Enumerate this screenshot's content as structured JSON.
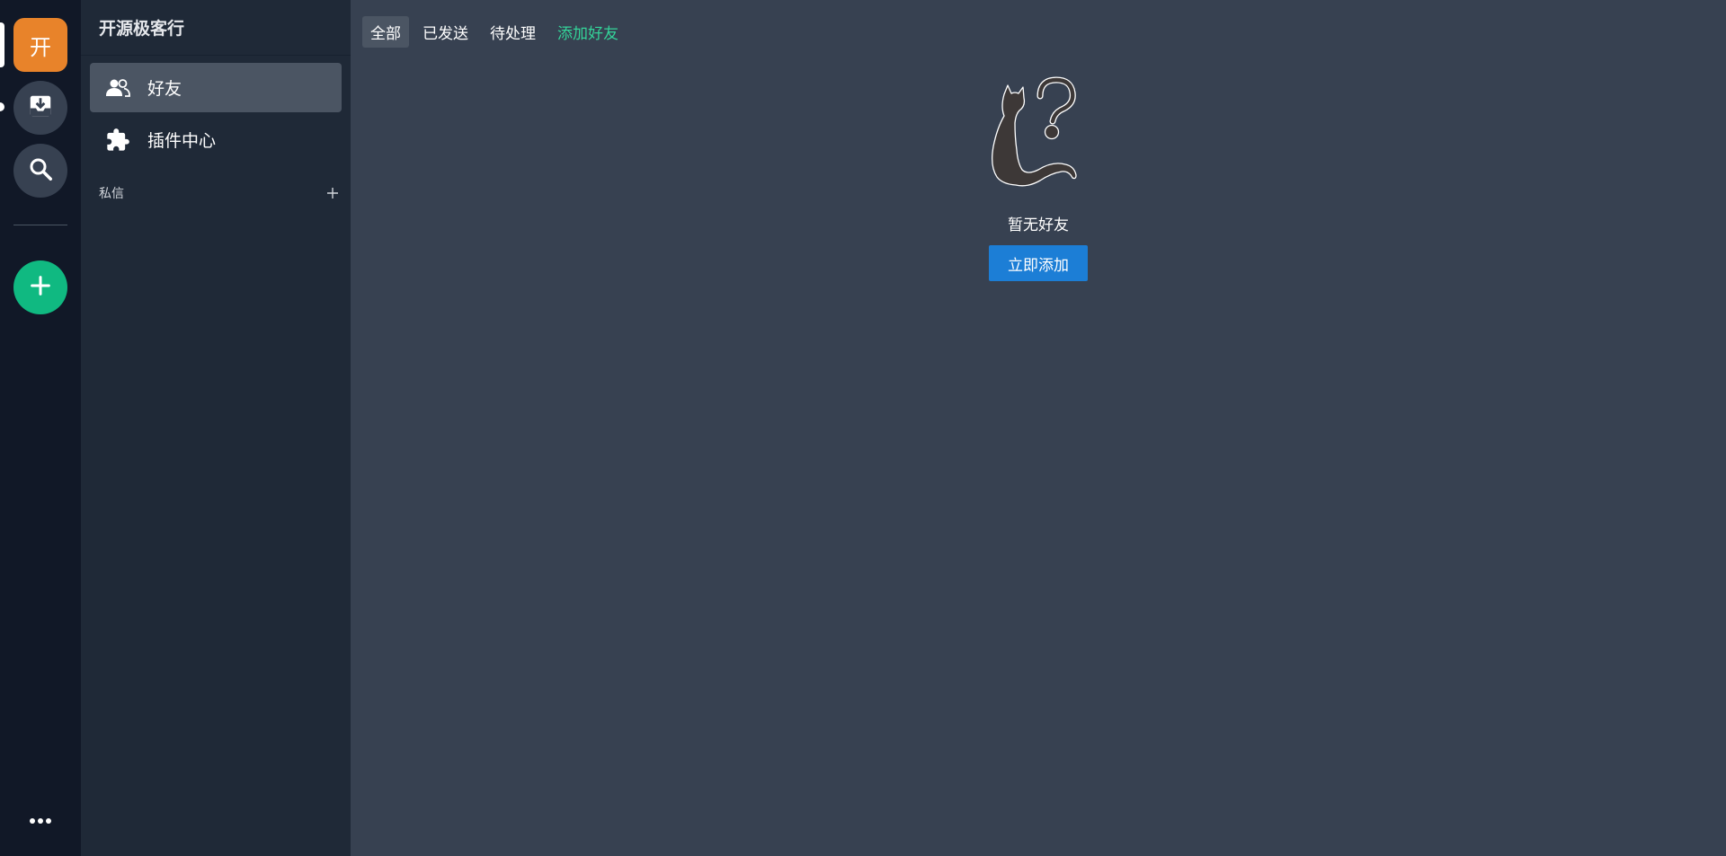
{
  "rail": {
    "server_initial": "开",
    "icons": {
      "inbox": "inbox-download-icon",
      "search": "search-icon",
      "add": "plus-icon",
      "more": "more-horizontal-icon"
    },
    "colors": {
      "server": "#e8832a",
      "add": "#10b981"
    }
  },
  "sidebar": {
    "server_name": "开源极客行",
    "items": [
      {
        "label": "好友",
        "icon": "friends-icon",
        "active": true
      },
      {
        "label": "插件中心",
        "icon": "puzzle-icon",
        "active": false
      }
    ],
    "dm_section": {
      "label": "私信",
      "add_icon": "plus-icon"
    }
  },
  "main": {
    "tabs": [
      {
        "label": "全部",
        "active": true
      },
      {
        "label": "已发送",
        "active": false
      },
      {
        "label": "待处理",
        "active": false
      },
      {
        "label": "添加好友",
        "active": false,
        "accent": true
      }
    ],
    "empty_state": {
      "illustration": "cat-question-illustration",
      "text": "暂无好友",
      "button_label": "立即添加"
    }
  },
  "colors": {
    "accent_green": "#34d399",
    "primary_button": "#1c7ed6"
  }
}
